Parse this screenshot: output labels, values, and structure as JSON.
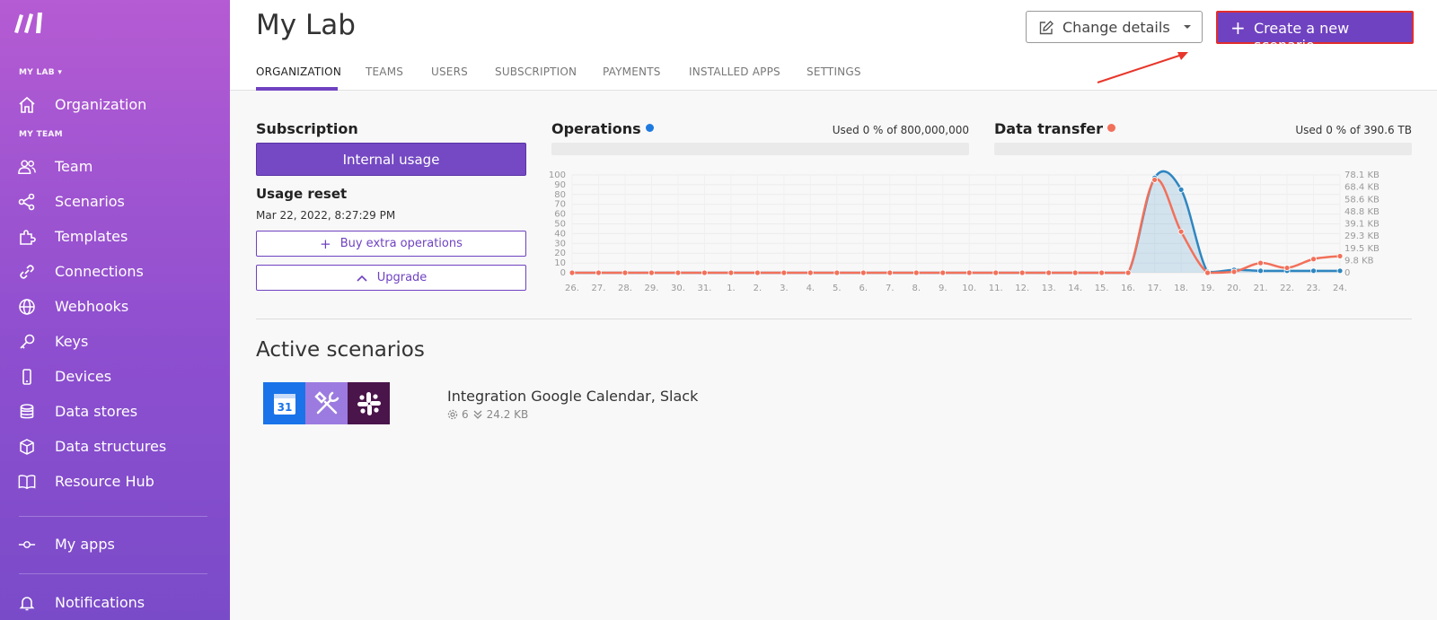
{
  "sidebar": {
    "my_lab_label": "MY LAB ▾",
    "my_team_label": "MY TEAM",
    "items": [
      {
        "label": "Organization",
        "icon": "home-icon"
      },
      {
        "label": "Team",
        "icon": "team-icon"
      },
      {
        "label": "Scenarios",
        "icon": "share-icon"
      },
      {
        "label": "Templates",
        "icon": "puzzle-icon"
      },
      {
        "label": "Connections",
        "icon": "link-icon"
      },
      {
        "label": "Webhooks",
        "icon": "globe-icon"
      },
      {
        "label": "Keys",
        "icon": "key-icon"
      },
      {
        "label": "Devices",
        "icon": "phone-icon"
      },
      {
        "label": "Data stores",
        "icon": "database-icon"
      },
      {
        "label": "Data structures",
        "icon": "cube-icon"
      },
      {
        "label": "Resource Hub",
        "icon": "book-icon"
      },
      {
        "label": "My apps",
        "icon": "apps-icon"
      },
      {
        "label": "Notifications",
        "icon": "bell-icon"
      }
    ]
  },
  "header": {
    "title": "My Lab",
    "change_details": "Change details",
    "create_scenario": "Create a new scenario",
    "tabs": [
      "ORGANIZATION",
      "TEAMS",
      "USERS",
      "SUBSCRIPTION",
      "PAYMENTS",
      "INSTALLED APPS",
      "SETTINGS"
    ]
  },
  "subscription": {
    "title": "Subscription",
    "plan": "Internal usage",
    "usage_reset_title": "Usage reset",
    "usage_reset_date": "Mar 22, 2022, 8:27:29 PM",
    "buy_extra": "Buy extra operations",
    "upgrade": "Upgrade"
  },
  "operations": {
    "title": "Operations",
    "used": "Used 0 % of 800,000,000",
    "color": "#1f7ae0",
    "used_percent": 0
  },
  "data_transfer": {
    "title": "Data transfer",
    "used": "Used 0 % of 390.6 TB",
    "color": "#f2705a",
    "used_percent": 0
  },
  "chart_data": {
    "type": "line",
    "x": [
      "26.",
      "27.",
      "28.",
      "29.",
      "30.",
      "31.",
      "1.",
      "2.",
      "3.",
      "4.",
      "5.",
      "6.",
      "7.",
      "8.",
      "9.",
      "10.",
      "11.",
      "12.",
      "13.",
      "14.",
      "15.",
      "16.",
      "17.",
      "18.",
      "19.",
      "20.",
      "21.",
      "22.",
      "23.",
      "24."
    ],
    "y_left_ticks": [
      "100",
      "90",
      "80",
      "70",
      "60",
      "50",
      "40",
      "30",
      "20",
      "10",
      "0"
    ],
    "y_right_ticks": [
      "78.1 KB",
      "68.4 KB",
      "58.6 KB",
      "48.8 KB",
      "39.1 KB",
      "29.3 KB",
      "19.5 KB",
      "9.8 KB",
      "0"
    ],
    "ylim": [
      0,
      100
    ],
    "series": [
      {
        "values": [
          0,
          0,
          0,
          0,
          0,
          0,
          0,
          0,
          0,
          0,
          0,
          0,
          0,
          0,
          0,
          0,
          0,
          0,
          0,
          0,
          0,
          0,
          97,
          85,
          1,
          3,
          2,
          2,
          2,
          2
        ],
        "color": "#2f86c0"
      },
      {
        "values": [
          0,
          0,
          0,
          0,
          0,
          0,
          0,
          0,
          0,
          0,
          0,
          0,
          0,
          0,
          0,
          0,
          0,
          0,
          0,
          0,
          0,
          0,
          95,
          42,
          0,
          1,
          10,
          5,
          14,
          17
        ],
        "color": "#f2705a"
      }
    ],
    "grid": true
  },
  "active": {
    "title": "Active scenarios",
    "scenarios": [
      {
        "name": "Integration Google Calendar, Slack",
        "ops": "6",
        "size": "24.2 KB",
        "calendar_day": "31"
      }
    ]
  }
}
